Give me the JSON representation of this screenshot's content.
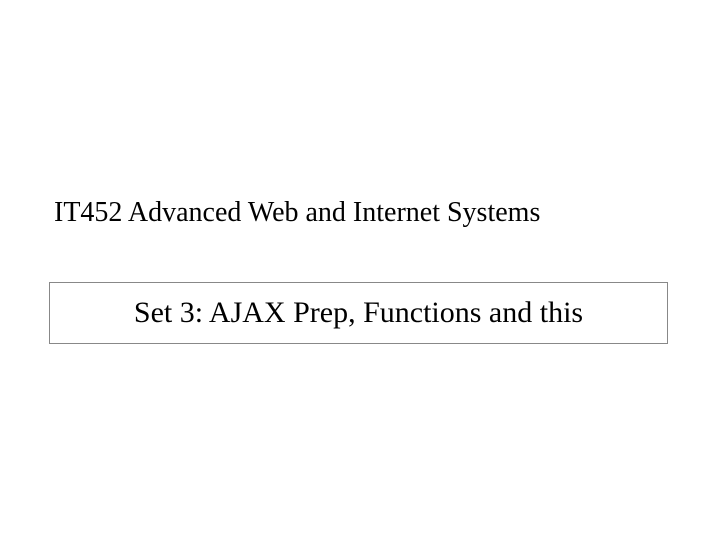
{
  "course_title": "IT452 Advanced Web and Internet Systems",
  "slide_title": "Set 3: AJAX Prep, Functions and this"
}
